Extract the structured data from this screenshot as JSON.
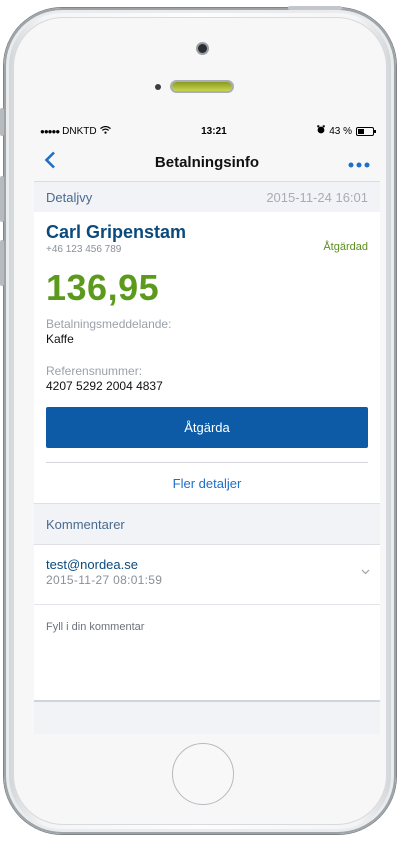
{
  "status": {
    "carrier": "DNKTD",
    "time": "13:21",
    "battery": "43 %"
  },
  "nav": {
    "back_icon": "chevron-left-icon",
    "title": "Betalningsinfo",
    "more_icon": "more-dots-icon"
  },
  "detail": {
    "label": "Detaljvy",
    "datetime": "2015-11-24 16:01"
  },
  "payment": {
    "name": "Carl Gripenstam",
    "phone": "+46 123 456 789",
    "status": "Åtgärdad",
    "amount": "136,95",
    "message_label": "Betalningsmeddelande:",
    "message_value": "Kaffe",
    "reference_label": "Referensnummer:",
    "reference_value": "4207 5292 2004 4837",
    "action_button": "Åtgärda",
    "more_link": "Fler detaljer"
  },
  "comments": {
    "header": "Kommentarer",
    "items": [
      {
        "email": "test@nordea.se",
        "date": "2015-11-27 08:01:59"
      }
    ],
    "input_placeholder": "Fyll i din kommentar"
  },
  "colors": {
    "accent_blue": "#0d5ba6",
    "amount_green": "#5c9a1d",
    "name_blue": "#0b4a7d"
  }
}
